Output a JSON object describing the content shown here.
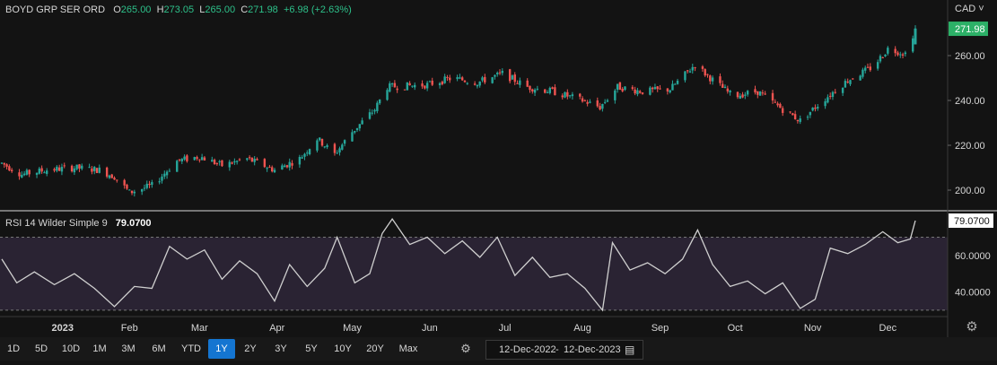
{
  "header": {
    "ticker": "BOYD GRP SER ORD",
    "open_label": "O",
    "open": "265.00",
    "high_label": "H",
    "high": "273.05",
    "low_label": "L",
    "low": "265.00",
    "close_label": "C",
    "close": "271.98",
    "change": "+6.98 (+2.63%)",
    "currency": "CAD"
  },
  "price_axis": {
    "ticks": [
      "260.00",
      "240.00",
      "220.00",
      "200.00"
    ],
    "last_price": "271.98"
  },
  "rsi": {
    "label": "RSI 14 Wilder Simple 9",
    "value": "79.0700",
    "ticks": [
      "60.0000",
      "40.0000"
    ]
  },
  "x_axis": {
    "labels": [
      "2023",
      "Feb",
      "Mar",
      "Apr",
      "May",
      "Jun",
      "Jul",
      "Aug",
      "Sep",
      "Oct",
      "Nov",
      "Dec"
    ]
  },
  "toolbar": {
    "ranges": [
      "1D",
      "5D",
      "10D",
      "1M",
      "3M",
      "6M",
      "YTD",
      "1Y",
      "2Y",
      "3Y",
      "5Y",
      "10Y",
      "20Y",
      "Max"
    ],
    "active": "1Y",
    "date_from": "12-Dec-2022",
    "date_sep": "-",
    "date_to": "12-Dec-2023"
  },
  "colors": {
    "up": "#26a69a",
    "down": "#ef5350",
    "rsi_line": "#cfcfcf",
    "rsi_band": "#2a2333",
    "active": "#1475d1"
  },
  "chart_data": [
    {
      "type": "candlestick",
      "title": "BOYD GRP SER ORD",
      "ylim": [
        192,
        276
      ],
      "x_range": [
        "2022-12-12",
        "2023-12-12"
      ],
      "close_path": [
        [
          "2022-12-12",
          212
        ],
        [
          "2022-12-20",
          207
        ],
        [
          "2022-12-30",
          209
        ],
        [
          "2023-01-10",
          210
        ],
        [
          "2023-01-20",
          209
        ],
        [
          "2023-01-26",
          206
        ],
        [
          "2023-02-01",
          199
        ],
        [
          "2023-02-10",
          202
        ],
        [
          "2023-02-20",
          213
        ],
        [
          "2023-03-01",
          215
        ],
        [
          "2023-03-10",
          211
        ],
        [
          "2023-03-20",
          214
        ],
        [
          "2023-03-31",
          209
        ],
        [
          "2023-04-10",
          214
        ],
        [
          "2023-04-17",
          223
        ],
        [
          "2023-04-24",
          216
        ],
        [
          "2023-05-01",
          226
        ],
        [
          "2023-05-10",
          236
        ],
        [
          "2023-05-15",
          246
        ],
        [
          "2023-05-31",
          247
        ],
        [
          "2023-06-10",
          250
        ],
        [
          "2023-06-20",
          248
        ],
        [
          "2023-06-30",
          252
        ],
        [
          "2023-07-10",
          246
        ],
        [
          "2023-07-20",
          244
        ],
        [
          "2023-08-01",
          240
        ],
        [
          "2023-08-08",
          237
        ],
        [
          "2023-08-15",
          246
        ],
        [
          "2023-08-25",
          244
        ],
        [
          "2023-09-05",
          245
        ],
        [
          "2023-09-15",
          256
        ],
        [
          "2023-09-20",
          251
        ],
        [
          "2023-09-30",
          242
        ],
        [
          "2023-10-10",
          244
        ],
        [
          "2023-10-20",
          236
        ],
        [
          "2023-10-27",
          231
        ],
        [
          "2023-11-05",
          240
        ],
        [
          "2023-11-15",
          249
        ],
        [
          "2023-11-25",
          255
        ],
        [
          "2023-12-01",
          263
        ],
        [
          "2023-12-08",
          261
        ],
        [
          "2023-12-12",
          271.98
        ]
      ]
    },
    {
      "type": "line",
      "title": "RSI 14 Wilder Simple 9",
      "ylim": [
        27,
        84
      ],
      "reference_lines": [
        70,
        30
      ],
      "points": [
        [
          "2022-12-12",
          58
        ],
        [
          "2022-12-18",
          45
        ],
        [
          "2022-12-25",
          51
        ],
        [
          "2023-01-02",
          44
        ],
        [
          "2023-01-10",
          50
        ],
        [
          "2023-01-18",
          42
        ],
        [
          "2023-01-26",
          32
        ],
        [
          "2023-02-03",
          43
        ],
        [
          "2023-02-10",
          42
        ],
        [
          "2023-02-17",
          65
        ],
        [
          "2023-02-24",
          58
        ],
        [
          "2023-03-03",
          63
        ],
        [
          "2023-03-10",
          47
        ],
        [
          "2023-03-17",
          57
        ],
        [
          "2023-03-24",
          50
        ],
        [
          "2023-03-31",
          35
        ],
        [
          "2023-04-06",
          55
        ],
        [
          "2023-04-13",
          43
        ],
        [
          "2023-04-20",
          53
        ],
        [
          "2023-04-25",
          70
        ],
        [
          "2023-05-02",
          45
        ],
        [
          "2023-05-08",
          50
        ],
        [
          "2023-05-13",
          72
        ],
        [
          "2023-05-17",
          80
        ],
        [
          "2023-05-24",
          66
        ],
        [
          "2023-05-31",
          70
        ],
        [
          "2023-06-07",
          61
        ],
        [
          "2023-06-14",
          68
        ],
        [
          "2023-06-21",
          59
        ],
        [
          "2023-06-28",
          70
        ],
        [
          "2023-07-05",
          49
        ],
        [
          "2023-07-12",
          59
        ],
        [
          "2023-07-19",
          48
        ],
        [
          "2023-07-26",
          50
        ],
        [
          "2023-08-02",
          42
        ],
        [
          "2023-08-09",
          30
        ],
        [
          "2023-08-13",
          67
        ],
        [
          "2023-08-20",
          52
        ],
        [
          "2023-08-27",
          56
        ],
        [
          "2023-09-03",
          50
        ],
        [
          "2023-09-10",
          58
        ],
        [
          "2023-09-16",
          74
        ],
        [
          "2023-09-22",
          55
        ],
        [
          "2023-09-29",
          43
        ],
        [
          "2023-10-06",
          46
        ],
        [
          "2023-10-13",
          39
        ],
        [
          "2023-10-20",
          45
        ],
        [
          "2023-10-27",
          31
        ],
        [
          "2023-11-02",
          36
        ],
        [
          "2023-11-08",
          64
        ],
        [
          "2023-11-15",
          61
        ],
        [
          "2023-11-22",
          66
        ],
        [
          "2023-11-29",
          73
        ],
        [
          "2023-12-05",
          67
        ],
        [
          "2023-12-10",
          69
        ],
        [
          "2023-12-12",
          79.07
        ]
      ]
    }
  ]
}
